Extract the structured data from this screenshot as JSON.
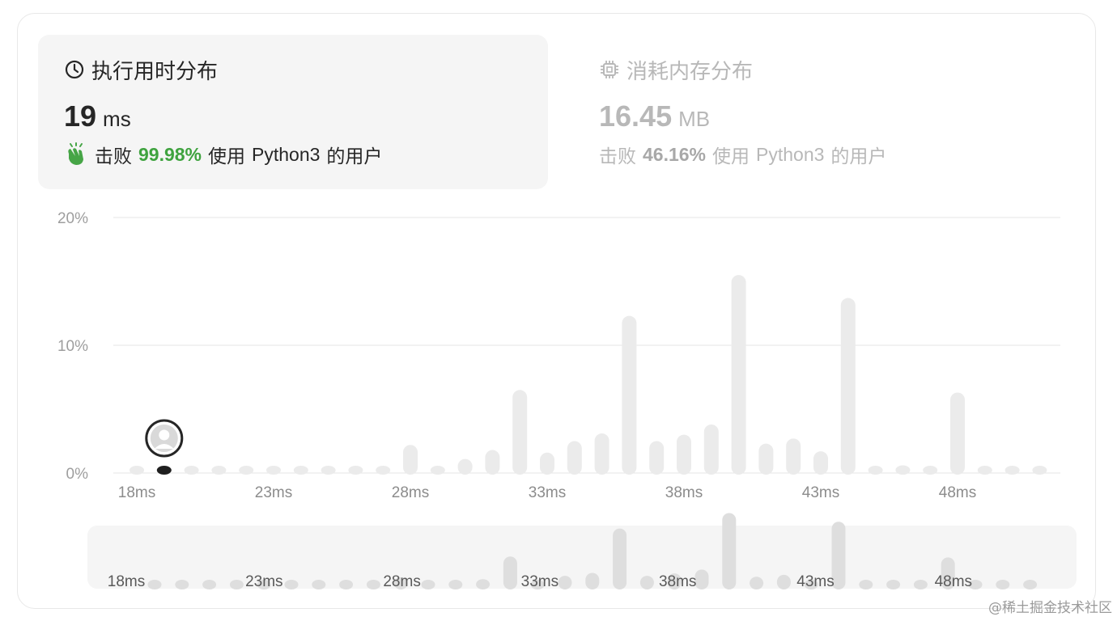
{
  "runtime": {
    "title": "执行用时分布",
    "value": "19",
    "unit": "ms",
    "beat_prefix": "击败",
    "beat_pct": "99.98%",
    "beat_suffix_pre": "使用",
    "language": "Python3",
    "beat_suffix_post": "的用户"
  },
  "memory": {
    "title": "消耗内存分布",
    "value": "16.45",
    "unit": "MB",
    "beat_prefix": "击败",
    "beat_pct": "46.16%",
    "beat_suffix_pre": "使用",
    "language": "Python3",
    "beat_suffix_post": "的用户"
  },
  "chart_data": {
    "type": "bar",
    "title": "",
    "xlabel": "",
    "ylabel": "",
    "ylim": [
      0,
      20
    ],
    "yticks": [
      "0%",
      "10%",
      "20%"
    ],
    "xticks": [
      "18ms",
      "23ms",
      "28ms",
      "33ms",
      "38ms",
      "43ms",
      "48ms"
    ],
    "x": [
      18,
      19,
      20,
      21,
      22,
      23,
      24,
      25,
      26,
      27,
      28,
      29,
      30,
      31,
      32,
      33,
      34,
      35,
      36,
      37,
      38,
      39,
      40,
      41,
      42,
      43,
      44,
      45,
      46,
      47,
      48,
      49,
      50,
      51
    ],
    "values": [
      0.1,
      0.1,
      0.1,
      0.1,
      0.1,
      0.1,
      0.1,
      0.1,
      0.1,
      0.5,
      2.2,
      0.5,
      1.1,
      1.8,
      6.5,
      1.6,
      2.5,
      3.1,
      12.3,
      2.5,
      3.0,
      3.8,
      15.5,
      2.3,
      2.7,
      1.7,
      13.7,
      0.5,
      0.6,
      0.3,
      6.3,
      0.1,
      0.1,
      0.1
    ],
    "highlight_x": 19,
    "grid": true,
    "colors": {
      "bar": "#ebebeb",
      "highlight": "#1f1f1f",
      "mini_bar": "#dedede"
    }
  },
  "watermark": "@稀土掘金技术社区"
}
